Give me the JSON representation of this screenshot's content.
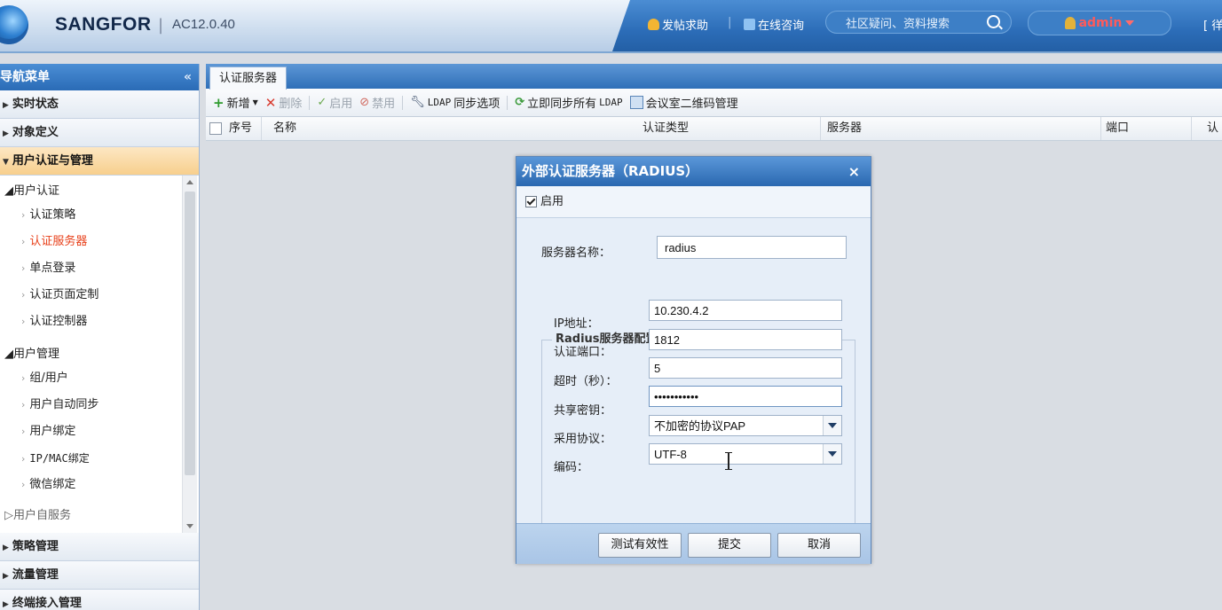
{
  "header": {
    "brand": "SANGFOR",
    "separator": "|",
    "version": "AC12.0.40",
    "post_help": "发帖求助",
    "online_consult": "在线咨询",
    "search_placeholder": "社区疑问、资料搜索",
    "username": "admin",
    "exit_partial": "[ 徉"
  },
  "sidebar": {
    "title": "导航菜单",
    "collapse_symbol": "«",
    "sections_top": [
      {
        "label": "实时状态"
      },
      {
        "label": "对象定义"
      },
      {
        "label": "用户认证与管理"
      }
    ],
    "tree": {
      "group1": "◢用户认证",
      "group1_items": [
        "认证策略",
        "认证服务器",
        "单点登录",
        "认证页面定制",
        "认证控制器"
      ],
      "group2": "◢用户管理",
      "group2_items": [
        "组/用户",
        "用户自动同步",
        "用户绑定",
        "IP/MAC绑定",
        "微信绑定"
      ],
      "group3_partial": "▷用户自服务"
    },
    "sections_bottom": [
      {
        "label": "策略管理"
      },
      {
        "label": "流量管理"
      },
      {
        "label": "终端接入管理"
      }
    ]
  },
  "tabs": [
    {
      "label": "认证服务器"
    }
  ],
  "toolbar": {
    "add": "新增",
    "delete": "删除",
    "enable": "启用",
    "disable": "禁用",
    "ldap_sync_options_prefix": "LDAP",
    "ldap_sync_options_suffix": "同步选项",
    "sync_all_prefix": "立即同步所有",
    "sync_all_suffix": "LDAP",
    "meeting_qr": "会议室二维码管理"
  },
  "grid": {
    "columns": [
      "序号",
      "名称",
      "认证类型",
      "服务器",
      "端口",
      "认"
    ]
  },
  "dialog": {
    "title": "外部认证服务器（RADIUS）",
    "close_symbol": "×",
    "enable_label": "启用",
    "enable_checked": true,
    "server_name_label": "服务器名称：",
    "server_name_value": "radius",
    "section_legend": "Radius服务器配置",
    "ip_label": "IP地址：",
    "ip_value": "10.230.4.2",
    "port_label": "认证端口：",
    "port_value": "1812",
    "timeout_label": "超时（秒）：",
    "timeout_value": "5",
    "secret_label": "共享密钥：",
    "secret_value": "•••••••••••",
    "protocol_label": "采用协议：",
    "protocol_value": "不加密的协议PAP",
    "encoding_label": "编码：",
    "encoding_value": "UTF-8",
    "test_button": "测试有效性",
    "submit_button": "提交",
    "cancel_button": "取消"
  }
}
